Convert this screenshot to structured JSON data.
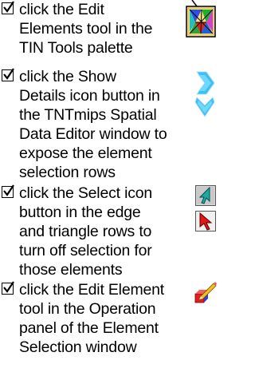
{
  "steps": [
    {
      "lines": [
        "click the Edit",
        "Elements tool in the",
        "TIN Tools palette"
      ],
      "icon": "edit-elements-tool-icon"
    },
    {
      "lines": [
        "click the Show",
        "Details icon button in",
        "the TNTmips Spatial",
        "Data Editor window to",
        "expose the element",
        "selection rows"
      ],
      "icon": "show-details-chevron-icon"
    },
    {
      "lines": [
        "click the Select icon",
        "button in the edge",
        "and triangle rows to",
        "turn off selection for",
        "those elements"
      ],
      "icon": "select-arrow-icon"
    },
    {
      "lines": [
        "click the Edit Element",
        "tool in the Operation",
        "panel of the Element",
        "Selection window"
      ],
      "icon": "edit-element-tool-icon"
    }
  ]
}
